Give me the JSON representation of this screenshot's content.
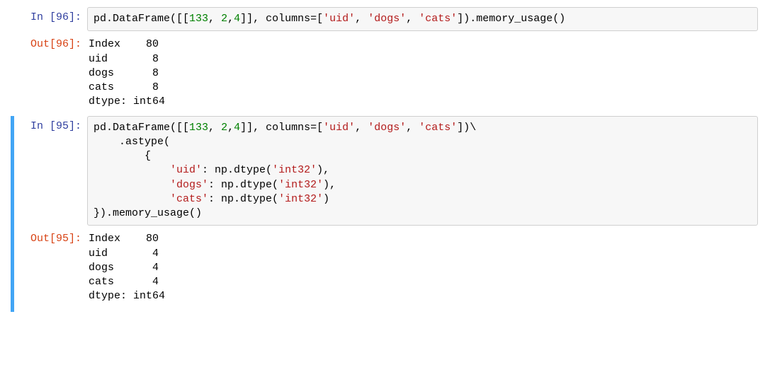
{
  "cells": {
    "c96": {
      "in_prompt": "In [96]:",
      "out_prompt": "Out[96]:",
      "code": {
        "t0": "pd.DataFrame([[",
        "n133": "133",
        "t1": ", ",
        "n2": "2",
        "t2": ",",
        "n4": "4",
        "t3": "]], columns",
        "eq": "=",
        "t4": "[",
        "s_uid": "'uid'",
        "t5": ", ",
        "s_dogs": "'dogs'",
        "t6": ", ",
        "s_cats": "'cats'",
        "t7": "]).memory_usage()"
      },
      "output": "Index    80\nuid       8\ndogs      8\ncats      8\ndtype: int64"
    },
    "c95": {
      "in_prompt": "In [95]:",
      "out_prompt": "Out[95]:",
      "code": {
        "l1a": "pd.DataFrame([[",
        "n133": "133",
        "l1b": ", ",
        "n2": "2",
        "l1c": ",",
        "n4": "4",
        "l1d": "]], columns",
        "eq": "=",
        "l1e": "[",
        "s_uid": "'uid'",
        "l1f": ", ",
        "s_dogs": "'dogs'",
        "l1g": ", ",
        "s_cats": "'cats'",
        "l1h": "])\\",
        "l2": "    .astype(",
        "l3": "        {",
        "l4a": "            ",
        "k_uid": "'uid'",
        "l4b": ": np.dtype(",
        "v_int32a": "'int32'",
        "l4c": "),",
        "l5a": "            ",
        "k_dogs": "'dogs'",
        "l5b": ": np.dtype(",
        "v_int32b": "'int32'",
        "l5c": "),",
        "l6a": "            ",
        "k_cats": "'cats'",
        "l6b": ": np.dtype(",
        "v_int32c": "'int32'",
        "l6c": ")",
        "l7": "}).memory_usage()"
      },
      "output": "Index    80\nuid       4\ndogs      4\ncats      4\ndtype: int64"
    }
  }
}
